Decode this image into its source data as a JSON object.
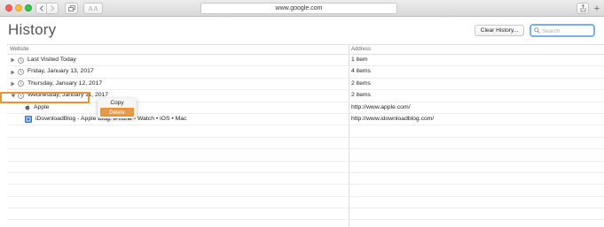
{
  "toolbar": {
    "url": "www.google.com",
    "reader_label": "A A",
    "new_tab_label": "+"
  },
  "header": {
    "title": "History",
    "clear_button": "Clear History...",
    "search_placeholder": "Search"
  },
  "table": {
    "columns": {
      "website": "Website",
      "address": "Address"
    },
    "groups": [
      {
        "label": "Last Visited Today",
        "count": "1 item",
        "expanded": false
      },
      {
        "label": "Friday, January 13, 2017",
        "count": "4 items",
        "expanded": false
      },
      {
        "label": "Thursday, January 12, 2017",
        "count": "2 items",
        "expanded": false
      },
      {
        "label": "Wednesday, January 11, 2017",
        "count": "2 items",
        "expanded": true
      }
    ],
    "items": [
      {
        "title": "Apple",
        "address": "http://www.apple.com/",
        "icon": "apple-icon"
      },
      {
        "title": "iDownloadBlog - Apple Blog: iPhone • Watch • iOS • Mac",
        "address": "http://www.idownloadblog.com/",
        "icon": "idb-favicon"
      }
    ]
  },
  "context_menu": {
    "copy": "Copy",
    "delete": "Delete"
  },
  "colors": {
    "highlight": "#f0922e",
    "search_focus": "#7ab0e8"
  }
}
